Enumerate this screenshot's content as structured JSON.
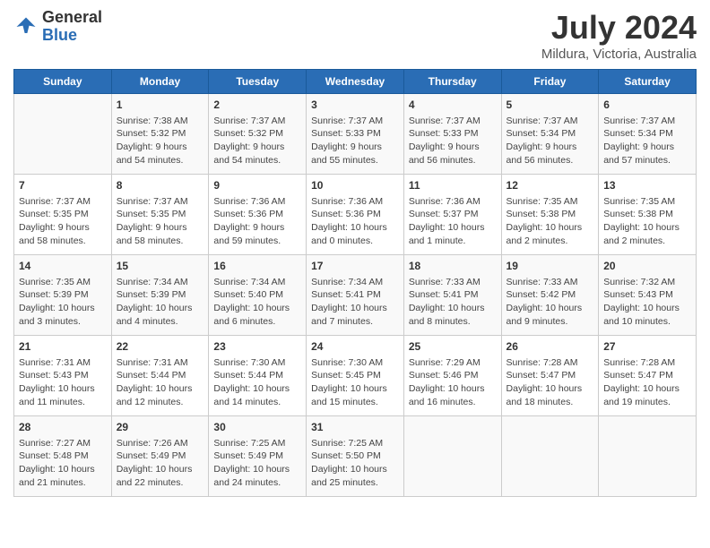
{
  "logo": {
    "general": "General",
    "blue": "Blue"
  },
  "title": "July 2024",
  "subtitle": "Mildura, Victoria, Australia",
  "weekdays": [
    "Sunday",
    "Monday",
    "Tuesday",
    "Wednesday",
    "Thursday",
    "Friday",
    "Saturday"
  ],
  "weeks": [
    [
      {
        "day": "",
        "info": ""
      },
      {
        "day": "1",
        "info": "Sunrise: 7:38 AM\nSunset: 5:32 PM\nDaylight: 9 hours\nand 54 minutes."
      },
      {
        "day": "2",
        "info": "Sunrise: 7:37 AM\nSunset: 5:32 PM\nDaylight: 9 hours\nand 54 minutes."
      },
      {
        "day": "3",
        "info": "Sunrise: 7:37 AM\nSunset: 5:33 PM\nDaylight: 9 hours\nand 55 minutes."
      },
      {
        "day": "4",
        "info": "Sunrise: 7:37 AM\nSunset: 5:33 PM\nDaylight: 9 hours\nand 56 minutes."
      },
      {
        "day": "5",
        "info": "Sunrise: 7:37 AM\nSunset: 5:34 PM\nDaylight: 9 hours\nand 56 minutes."
      },
      {
        "day": "6",
        "info": "Sunrise: 7:37 AM\nSunset: 5:34 PM\nDaylight: 9 hours\nand 57 minutes."
      }
    ],
    [
      {
        "day": "7",
        "info": "Sunrise: 7:37 AM\nSunset: 5:35 PM\nDaylight: 9 hours\nand 58 minutes."
      },
      {
        "day": "8",
        "info": "Sunrise: 7:37 AM\nSunset: 5:35 PM\nDaylight: 9 hours\nand 58 minutes."
      },
      {
        "day": "9",
        "info": "Sunrise: 7:36 AM\nSunset: 5:36 PM\nDaylight: 9 hours\nand 59 minutes."
      },
      {
        "day": "10",
        "info": "Sunrise: 7:36 AM\nSunset: 5:36 PM\nDaylight: 10 hours\nand 0 minutes."
      },
      {
        "day": "11",
        "info": "Sunrise: 7:36 AM\nSunset: 5:37 PM\nDaylight: 10 hours\nand 1 minute."
      },
      {
        "day": "12",
        "info": "Sunrise: 7:35 AM\nSunset: 5:38 PM\nDaylight: 10 hours\nand 2 minutes."
      },
      {
        "day": "13",
        "info": "Sunrise: 7:35 AM\nSunset: 5:38 PM\nDaylight: 10 hours\nand 2 minutes."
      }
    ],
    [
      {
        "day": "14",
        "info": "Sunrise: 7:35 AM\nSunset: 5:39 PM\nDaylight: 10 hours\nand 3 minutes."
      },
      {
        "day": "15",
        "info": "Sunrise: 7:34 AM\nSunset: 5:39 PM\nDaylight: 10 hours\nand 4 minutes."
      },
      {
        "day": "16",
        "info": "Sunrise: 7:34 AM\nSunset: 5:40 PM\nDaylight: 10 hours\nand 6 minutes."
      },
      {
        "day": "17",
        "info": "Sunrise: 7:34 AM\nSunset: 5:41 PM\nDaylight: 10 hours\nand 7 minutes."
      },
      {
        "day": "18",
        "info": "Sunrise: 7:33 AM\nSunset: 5:41 PM\nDaylight: 10 hours\nand 8 minutes."
      },
      {
        "day": "19",
        "info": "Sunrise: 7:33 AM\nSunset: 5:42 PM\nDaylight: 10 hours\nand 9 minutes."
      },
      {
        "day": "20",
        "info": "Sunrise: 7:32 AM\nSunset: 5:43 PM\nDaylight: 10 hours\nand 10 minutes."
      }
    ],
    [
      {
        "day": "21",
        "info": "Sunrise: 7:31 AM\nSunset: 5:43 PM\nDaylight: 10 hours\nand 11 minutes."
      },
      {
        "day": "22",
        "info": "Sunrise: 7:31 AM\nSunset: 5:44 PM\nDaylight: 10 hours\nand 12 minutes."
      },
      {
        "day": "23",
        "info": "Sunrise: 7:30 AM\nSunset: 5:44 PM\nDaylight: 10 hours\nand 14 minutes."
      },
      {
        "day": "24",
        "info": "Sunrise: 7:30 AM\nSunset: 5:45 PM\nDaylight: 10 hours\nand 15 minutes."
      },
      {
        "day": "25",
        "info": "Sunrise: 7:29 AM\nSunset: 5:46 PM\nDaylight: 10 hours\nand 16 minutes."
      },
      {
        "day": "26",
        "info": "Sunrise: 7:28 AM\nSunset: 5:47 PM\nDaylight: 10 hours\nand 18 minutes."
      },
      {
        "day": "27",
        "info": "Sunrise: 7:28 AM\nSunset: 5:47 PM\nDaylight: 10 hours\nand 19 minutes."
      }
    ],
    [
      {
        "day": "28",
        "info": "Sunrise: 7:27 AM\nSunset: 5:48 PM\nDaylight: 10 hours\nand 21 minutes."
      },
      {
        "day": "29",
        "info": "Sunrise: 7:26 AM\nSunset: 5:49 PM\nDaylight: 10 hours\nand 22 minutes."
      },
      {
        "day": "30",
        "info": "Sunrise: 7:25 AM\nSunset: 5:49 PM\nDaylight: 10 hours\nand 24 minutes."
      },
      {
        "day": "31",
        "info": "Sunrise: 7:25 AM\nSunset: 5:50 PM\nDaylight: 10 hours\nand 25 minutes."
      },
      {
        "day": "",
        "info": ""
      },
      {
        "day": "",
        "info": ""
      },
      {
        "day": "",
        "info": ""
      }
    ]
  ]
}
